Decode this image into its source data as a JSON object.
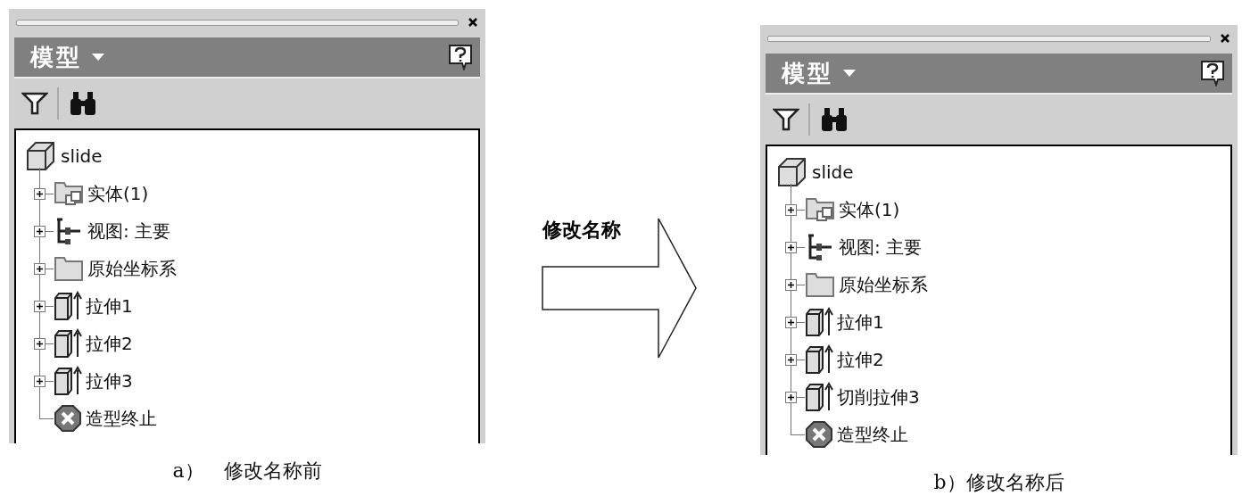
{
  "panels": [
    {
      "title": "模型",
      "root": {
        "label": "slide",
        "kind": "part",
        "children": [
          {
            "label": "实体(1)",
            "kind": "bodies",
            "expanded": false
          },
          {
            "label": "视图: 主要",
            "kind": "view",
            "expanded": false
          },
          {
            "label": "原始坐标系",
            "kind": "folder",
            "expanded": false
          },
          {
            "label": "拉伸1",
            "kind": "extrude",
            "expanded": false
          },
          {
            "label": "拉伸2",
            "kind": "extrude",
            "expanded": false
          },
          {
            "label": "拉伸3",
            "kind": "extrude",
            "expanded": false
          },
          {
            "label": "造型终止",
            "kind": "end"
          }
        ]
      },
      "caption": "a）　修改名称前"
    },
    {
      "title": "模型",
      "root": {
        "label": "slide",
        "kind": "part",
        "children": [
          {
            "label": "实体(1)",
            "kind": "bodies",
            "expanded": false
          },
          {
            "label": "视图: 主要",
            "kind": "view",
            "expanded": false
          },
          {
            "label": "原始坐标系",
            "kind": "folder",
            "expanded": false
          },
          {
            "label": "拉伸1",
            "kind": "extrude",
            "expanded": false
          },
          {
            "label": "拉伸2",
            "kind": "extrude",
            "expanded": false
          },
          {
            "label": "切削拉伸3",
            "kind": "extrude",
            "expanded": false
          },
          {
            "label": "造型终止",
            "kind": "end"
          }
        ]
      },
      "caption": "b）修改名称后"
    }
  ],
  "arrow_label": "修改名称"
}
